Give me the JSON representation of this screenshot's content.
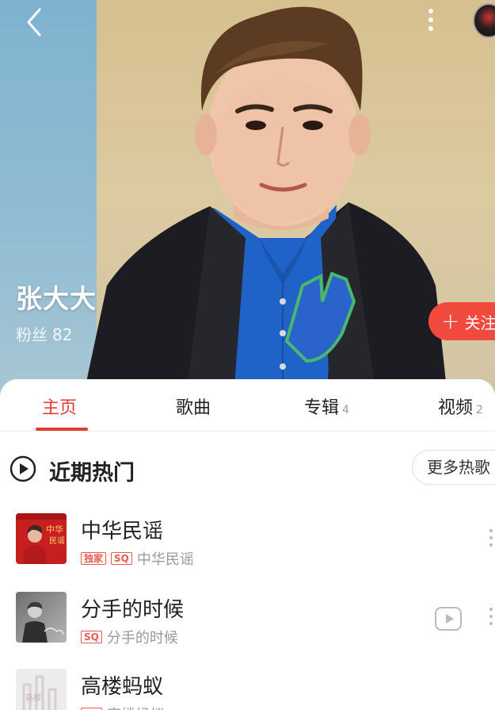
{
  "header": {
    "back_icon": "chevron-left-icon",
    "more_icon": "vertical-dots-icon"
  },
  "artist": {
    "name": "张大大",
    "fans_label": "粉丝",
    "fans_count": "82",
    "follow_label": "关注"
  },
  "tabs": [
    {
      "label": "主页",
      "count": "",
      "active": true
    },
    {
      "label": "歌曲",
      "count": ""
    },
    {
      "label": "专辑",
      "count": "4"
    },
    {
      "label": "视频",
      "count": "2"
    }
  ],
  "hot": {
    "title": "近期热门",
    "more_label": "更多热歌"
  },
  "songs": [
    {
      "title": "中华民谣",
      "tags": [
        "独家",
        "SQ"
      ],
      "subtitle": "中华民谣",
      "has_mv": false
    },
    {
      "title": "分手的时候",
      "tags": [
        "SQ"
      ],
      "subtitle": "分手的时候",
      "has_mv": true
    },
    {
      "title": "高楼蚂蚁",
      "tags": [
        "SQ"
      ],
      "subtitle": "高楼蚂蚁",
      "has_mv": false
    }
  ],
  "colors": {
    "accent": "#e33c30",
    "follow_button": "#f04a3e",
    "tag": "#e95a4f"
  }
}
